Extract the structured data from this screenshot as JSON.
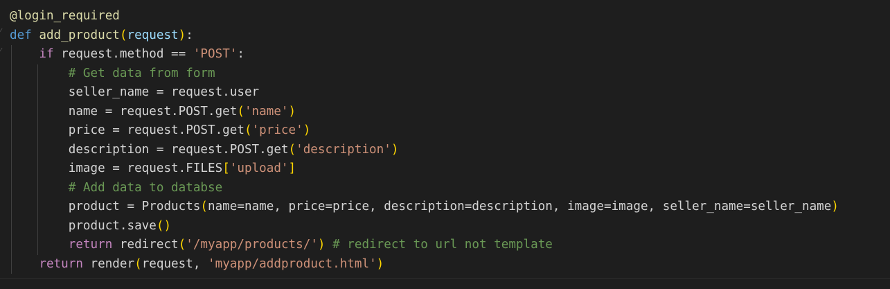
{
  "editor": {
    "language": "python",
    "theme_colors": {
      "background": "#1e1e1e",
      "keyword": "#569cd6",
      "control": "#c586c0",
      "function": "#dcdcaa",
      "parameter": "#9cdcfe",
      "string": "#ce9178",
      "comment": "#6a9955",
      "bracket_level1": "#ffd700",
      "bracket_level2": "#da70d6",
      "text": "#d4d4d4"
    },
    "lines": [
      {
        "tokens": [
          {
            "t": "fn",
            "v": "@login_required"
          }
        ]
      },
      {
        "tokens": [
          {
            "t": "kw",
            "v": "def"
          },
          {
            "t": "plain",
            "v": " "
          },
          {
            "t": "fn",
            "v": "add_product"
          },
          {
            "t": "brace1",
            "v": "("
          },
          {
            "t": "param",
            "v": "request"
          },
          {
            "t": "brace1",
            "v": ")"
          },
          {
            "t": "plain",
            "v": ":"
          }
        ]
      },
      {
        "tokens": [
          {
            "t": "plain",
            "v": "    "
          },
          {
            "t": "ctrl",
            "v": "if"
          },
          {
            "t": "plain",
            "v": " request.method == "
          },
          {
            "t": "str",
            "v": "'POST'"
          },
          {
            "t": "plain",
            "v": ":"
          }
        ]
      },
      {
        "tokens": [
          {
            "t": "plain",
            "v": "        "
          },
          {
            "t": "cmt",
            "v": "# Get data from form"
          }
        ]
      },
      {
        "tokens": [
          {
            "t": "plain",
            "v": "        seller_name = request.user"
          }
        ]
      },
      {
        "tokens": [
          {
            "t": "plain",
            "v": "        name = request.POST.get"
          },
          {
            "t": "brace1",
            "v": "("
          },
          {
            "t": "str",
            "v": "'name'"
          },
          {
            "t": "brace1",
            "v": ")"
          }
        ]
      },
      {
        "tokens": [
          {
            "t": "plain",
            "v": "        price = request.POST.get"
          },
          {
            "t": "brace1",
            "v": "("
          },
          {
            "t": "str",
            "v": "'price'"
          },
          {
            "t": "brace1",
            "v": ")"
          }
        ]
      },
      {
        "tokens": [
          {
            "t": "plain",
            "v": "        description = request.POST.get"
          },
          {
            "t": "brace1",
            "v": "("
          },
          {
            "t": "str",
            "v": "'description'"
          },
          {
            "t": "brace1",
            "v": ")"
          }
        ]
      },
      {
        "tokens": [
          {
            "t": "plain",
            "v": "        image = request.FILES"
          },
          {
            "t": "brace1",
            "v": "["
          },
          {
            "t": "str",
            "v": "'upload'"
          },
          {
            "t": "brace1",
            "v": "]"
          }
        ]
      },
      {
        "tokens": [
          {
            "t": "plain",
            "v": "        "
          },
          {
            "t": "cmt",
            "v": "# Add data to databse"
          }
        ]
      },
      {
        "tokens": [
          {
            "t": "plain",
            "v": "        product = Products"
          },
          {
            "t": "brace1",
            "v": "("
          },
          {
            "t": "plain",
            "v": "name=name, price=price, description=description, image=image, seller_name=seller_name"
          },
          {
            "t": "brace1",
            "v": ")"
          }
        ]
      },
      {
        "tokens": [
          {
            "t": "plain",
            "v": "        product.save"
          },
          {
            "t": "brace1",
            "v": "()"
          }
        ]
      },
      {
        "tokens": [
          {
            "t": "plain",
            "v": "        "
          },
          {
            "t": "ctrl",
            "v": "return"
          },
          {
            "t": "plain",
            "v": " redirect"
          },
          {
            "t": "brace1",
            "v": "("
          },
          {
            "t": "str",
            "v": "'/myapp/products/'"
          },
          {
            "t": "brace1",
            "v": ")"
          },
          {
            "t": "plain",
            "v": " "
          },
          {
            "t": "cmt",
            "v": "# redirect to url not template"
          }
        ]
      },
      {
        "tokens": [
          {
            "t": "plain",
            "v": "    "
          },
          {
            "t": "ctrl",
            "v": "return"
          },
          {
            "t": "plain",
            "v": " render"
          },
          {
            "t": "brace1",
            "v": "("
          },
          {
            "t": "plain",
            "v": "request, "
          },
          {
            "t": "str",
            "v": "'myapp/addproduct.html'"
          },
          {
            "t": "brace1",
            "v": ")"
          }
        ]
      }
    ]
  }
}
